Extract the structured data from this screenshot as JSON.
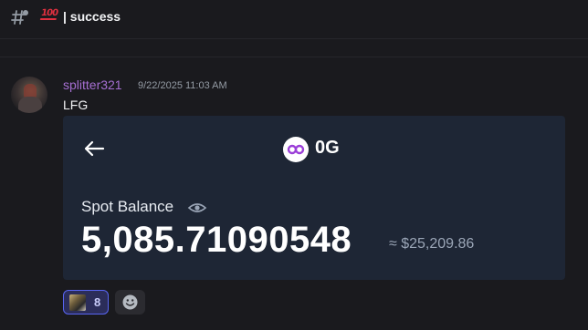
{
  "header": {
    "channel_icon": "hash-threads-icon",
    "emoji": "💯",
    "emoji_name": "hundred-points-emoji",
    "channel_name": "| success"
  },
  "message": {
    "username": "splitter321",
    "username_color": "#a66fd2",
    "timestamp": "9/22/2025 11:03 AM",
    "text": "LFG",
    "avatar": "user-avatar"
  },
  "card": {
    "back_icon": "back-arrow-icon",
    "coin_icon": "0g-coin-icon",
    "coin_name": "0G",
    "balance_label": "Spot Balance",
    "eye_icon": "eye-icon",
    "balance_value": "5,085.71090548",
    "balance_usd": "≈ $25,209.86",
    "background": "#1e2635"
  },
  "reactions": [
    {
      "emoji": "custom-image-emoji",
      "count": "8",
      "active": true
    }
  ],
  "add_reaction_icon": "smile-add-reaction-icon",
  "colors": {
    "background": "#1a1a1e",
    "accent": "#5865f2"
  }
}
